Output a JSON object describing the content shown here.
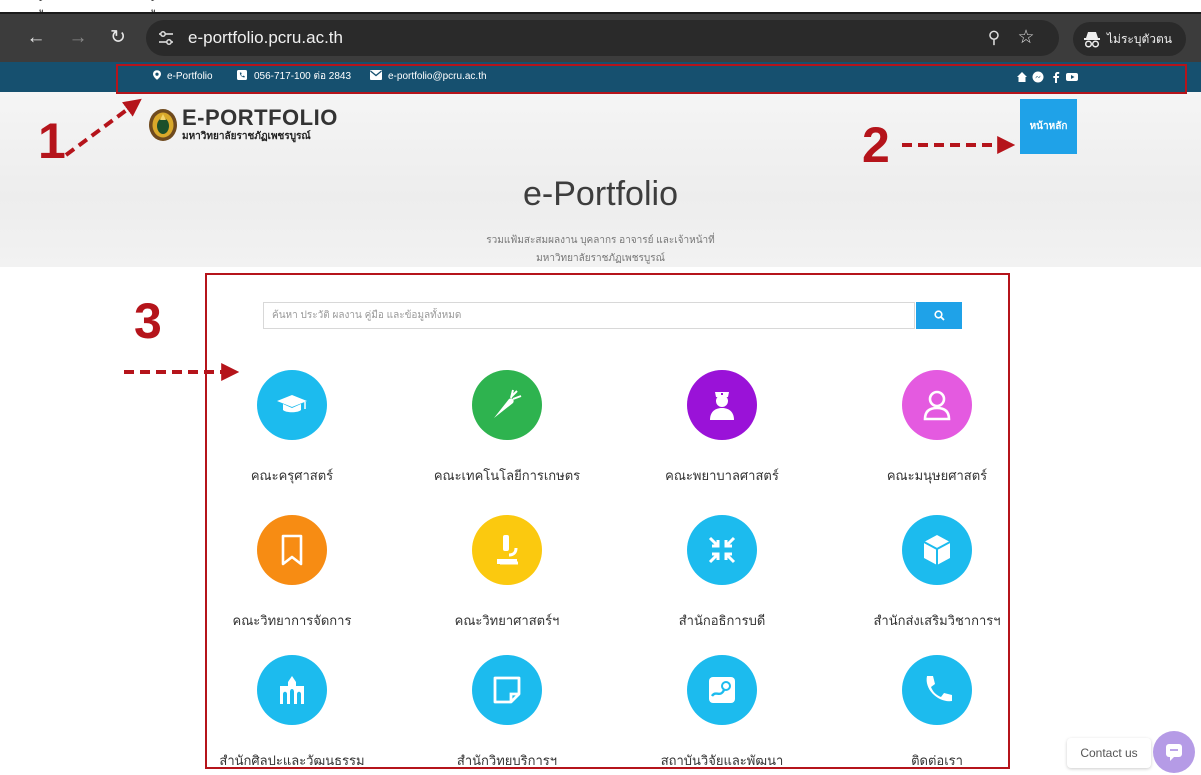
{
  "browser": {
    "url": "e-portfolio.pcru.ac.th",
    "profile_label": "ไม่ระบุตัวตน"
  },
  "cropped_text": [
    "ู้",
    "ู้"
  ],
  "topbar": {
    "site_label": "e-Portfolio",
    "phone": "056-717-100 ต่อ 2843",
    "email": "e-portfolio@pcru.ac.th"
  },
  "header": {
    "logo_title": "E-PORTFOLIO",
    "logo_subtitle": "มหาวิทยาลัยราชภัฏเพชรบูรณ์",
    "home_label": "หน้าหลัก",
    "hero_title": "e-Portfolio",
    "hero_sub1": "รวมแฟ้มสะสมผลงาน บุคลากร อาจารย์ และเจ้าหน้าที่",
    "hero_sub2": "มหาวิทยาลัยราชภัฏเพชรบูรณ์"
  },
  "search": {
    "placeholder": "ค้นหา ประวัติ ผลงาน คู่มือ และข้อมูลทั้งหมด"
  },
  "tiles": [
    {
      "label": "คณะครุศาสตร์",
      "icon": "graduation-cap-icon",
      "color": "#1cbbee"
    },
    {
      "label": "คณะเทคโนโลยีการเกษตร",
      "icon": "carrot-icon",
      "color": "#2eb34f"
    },
    {
      "label": "คณะพยาบาลศาสตร์",
      "icon": "nurse-icon",
      "color": "#9a12d8"
    },
    {
      "label": "คณะมนุษยศาสตร์",
      "icon": "user-icon",
      "color": "#e45ae0"
    },
    {
      "label": "คณะวิทยาการจัดการ",
      "icon": "bookmark-icon",
      "color": "#f78c13"
    },
    {
      "label": "คณะวิทยาศาสตร์ฯ",
      "icon": "microscope-icon",
      "color": "#fbc90f"
    },
    {
      "label": "สำนักอธิการบดี",
      "icon": "compress-icon",
      "color": "#1cbbee"
    },
    {
      "label": "สำนักส่งเสริมวิชาการฯ",
      "icon": "cube-icon",
      "color": "#1cbbee"
    },
    {
      "label": "สำนักศิลปะและวัฒนธรรม",
      "icon": "temple-icon",
      "color": "#1cbbee"
    },
    {
      "label": "สำนักวิทยบริการฯ",
      "icon": "sticky-note-icon",
      "color": "#1cbbee"
    },
    {
      "label": "สถาบันวิจัยและพัฒนา",
      "icon": "research-icon",
      "color": "#1cbbee"
    },
    {
      "label": "ติดต่อเรา",
      "icon": "phone-icon",
      "color": "#1cbbee"
    }
  ],
  "annotations": {
    "n1": "1",
    "n2": "2",
    "n3": "3"
  },
  "contact": {
    "label": "Contact us"
  }
}
